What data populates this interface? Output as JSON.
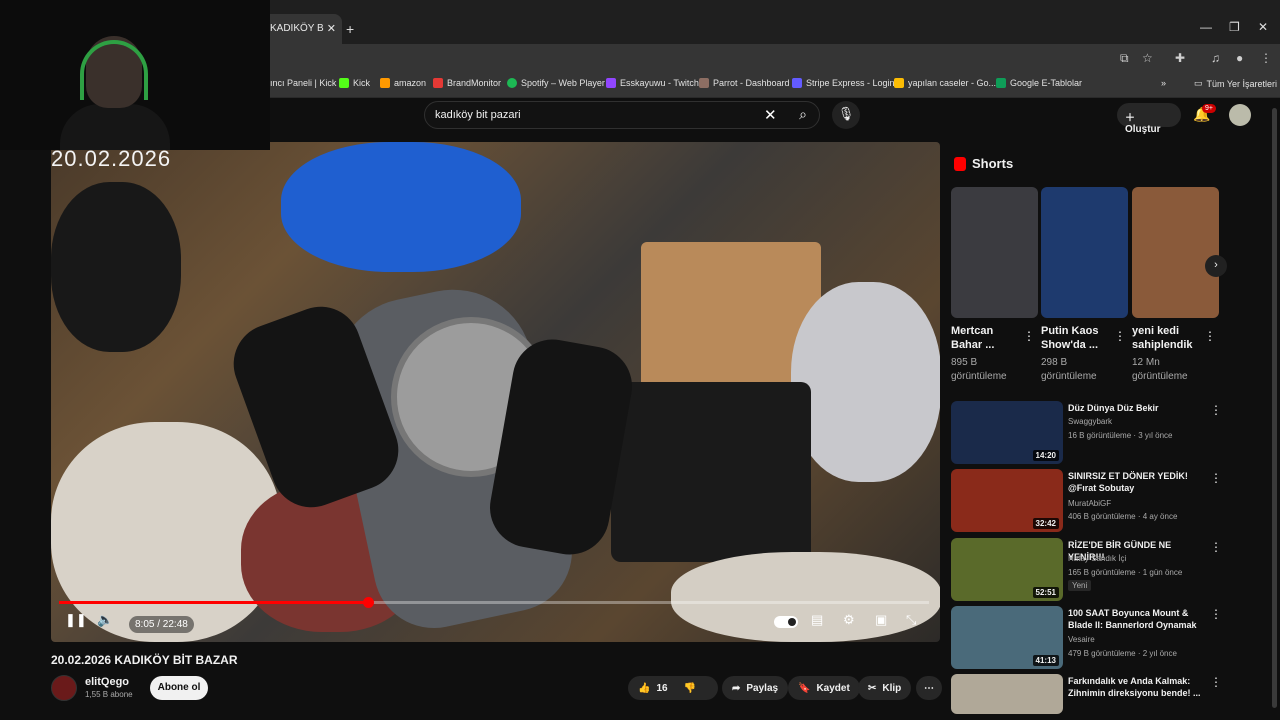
{
  "browser": {
    "tab_title": "KADIKÖY B",
    "bookmarks": [
      {
        "label": "ıncı Paneli | Kick",
        "color": "#53fc18"
      },
      {
        "label": "Kick",
        "color": "#53fc18"
      },
      {
        "label": "amazon",
        "color": "#ff9900"
      },
      {
        "label": "BrandMonitor",
        "color": "#e53935"
      },
      {
        "label": "Spotify – Web Player",
        "color": "#1db954"
      },
      {
        "label": "Esskayuwu - Twitch",
        "color": "#9146ff"
      },
      {
        "label": "Parrot - Dashboard",
        "color": "#8d6e63"
      },
      {
        "label": "Stripe Express - Login",
        "color": "#635bff"
      },
      {
        "label": "yapılan caseler - Go...",
        "color": "#fbbc04"
      },
      {
        "label": "Google E-Tablolar",
        "color": "#0f9d58"
      }
    ],
    "all_bookmarks": "Tüm Yer İşaretleri"
  },
  "header": {
    "search_value": "kadıköy bit pazari",
    "create_label": "Oluştur",
    "notif_count": "9+"
  },
  "video": {
    "overlay_date": "20.02.2026",
    "time": "8:05 / 22:48",
    "progress_fraction": 0.355,
    "title": "20.02.2026 KADIKÖY BİT BAZAR",
    "channel": "elitQego",
    "subs": "1,55 B abone",
    "subscribe_label": "Abone ol",
    "likes": "16",
    "share_label": "Paylaş",
    "save_label": "Kaydet",
    "clip_label": "Klip"
  },
  "shorts": {
    "heading": "Shorts",
    "items": [
      {
        "title": "Mertcan Bahar ...",
        "views": "895 B görüntüleme",
        "color": "#3b3b40"
      },
      {
        "title": "Putin Kaos Show'da ...",
        "views": "298 B görüntüleme",
        "color": "#1e3a6e"
      },
      {
        "title": "yeni kedi sahiplendik",
        "views": "12 Mn görüntüleme",
        "color": "#8a5a3a"
      }
    ]
  },
  "recommended": [
    {
      "title": "Düz Dünya Düz Bekir",
      "channel": "Swaggybark",
      "meta": "16 B görüntüleme · 3 yıl önce",
      "duration": "14:20",
      "tag": "",
      "color": "#1a2a4a"
    },
    {
      "title": "SINIRSIZ ET DÖNER YEDİK! @Fırat Sobutay",
      "channel": "MuratAbiGF",
      "meta": "406 B görüntüleme · 4 ay önce",
      "duration": "32:42",
      "tag": "",
      "color": "#8a2a1a"
    },
    {
      "title": "RİZE'DE BİR GÜNDE NE YENİR!!!",
      "channel": "Hatay Sandık İçi",
      "meta": "165 B görüntüleme · 1 gün önce",
      "duration": "52:51",
      "tag": "Yeni",
      "color": "#5a6a2a"
    },
    {
      "title": "100 SAAT Boyunca Mount & Blade II: Bannerlord Oynamak",
      "channel": "Vesaire",
      "meta": "479 B görüntüleme · 2 yıl önce",
      "duration": "41:13",
      "tag": "",
      "color": "#4a6a7a"
    },
    {
      "title": "Farkındalık ve Anda Kalmak: Zihnimin direksiyonu bende! ...",
      "channel": "",
      "meta": "",
      "duration": "",
      "tag": "",
      "color": "#b0a898"
    }
  ]
}
